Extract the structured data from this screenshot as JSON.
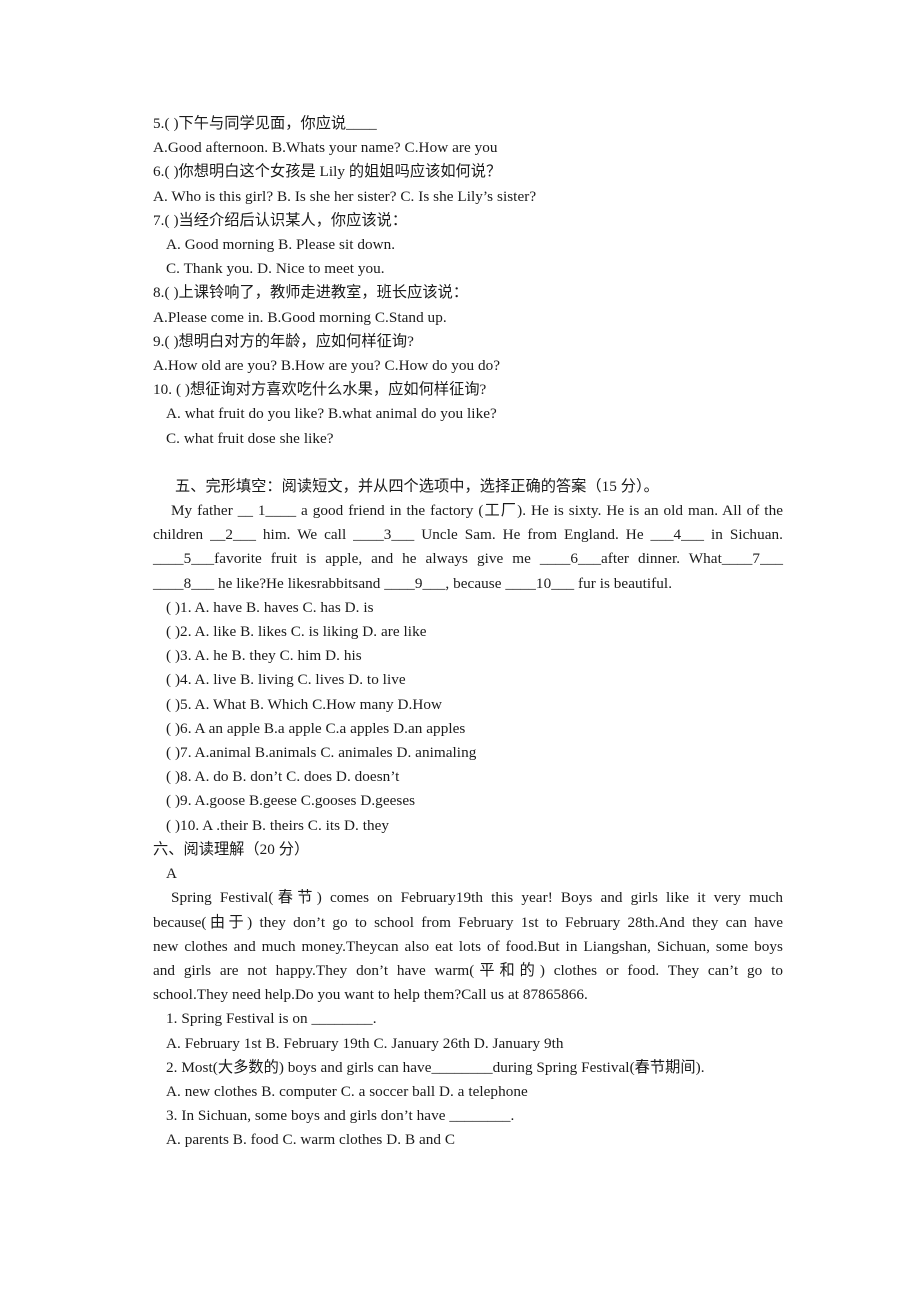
{
  "document": {
    "type": "exam-worksheet",
    "language": "zh-CN/en",
    "page_background": "#ffffff",
    "text_color": "#1a1a1a"
  },
  "part_four_items": [
    "5.( )下午与同学见面，你应说____",
    "A.Good afternoon. B.Whats your name? C.How are you",
    "6.( )你想明白这个女孩是 Lily 的姐姐吗应该如何说？",
    "A. Who is this girl? B. Is she her sister? C. Is she Lily’s sister?",
    "7.( )当经介绍后认识某人，你应该说：",
    "A. Good morning B. Please sit down.",
    "C. Thank you. D. Nice to meet you.",
    "8.( )上课铃响了，教师走进教室，班长应该说：",
    "A.Please come in. B.Good morning C.Stand up.",
    "9.( )想明白对方的年龄，应如何样征询?",
    "A.How old are you? B.How are you? C.How do you do?",
    "10. ( )想征询对方喜欢吃什么水果，应如何样征询?",
    "A. what fruit do you like? B.what animal do you like?",
    "C. what fruit dose she like?"
  ],
  "section_five": {
    "heading": "五、完形填空：阅读短文，并从四个选项中，选择正确的答案（15 分）。",
    "passage_lines": [
      "My father __ 1____ a good friend in the factory (工厂). He is sixty. He is an old man. All of the",
      "children __2___ him. We call ____3___ Uncle Sam. He from England. He ___4___ in Sichuan.",
      "____5___favorite fruit is apple, and he always give me ____6___after dinner. What____7___",
      "____8___ he like?He likesrabbitsand ____9___, because ____10___ fur is beautiful."
    ],
    "options": [
      "( )1. A. have B. haves C. has D. is",
      "( )2. A. like B. likes C. is liking D. are like",
      "( )3. A. he B. they C. him D. his",
      "( )4. A. live B. living C. lives D. to live",
      "( )5. A. What B. Which C.How many D.How",
      "( )6. A an apple B.a apple C.a apples D.an apples",
      "( )7. A.animal B.animals C. animales D. animaling",
      "( )8. A. do B. don’t C. does D. doesn’t",
      "( )9. A.goose B.geese C.gooses D.geeses",
      "( )10. A .their B. theirs C. its D. they"
    ]
  },
  "section_six": {
    "heading": "六、阅读理解（20 分）",
    "passage_label": "A",
    "passage_lines": [
      "Spring Festival(春节) comes on February19th this year! Boys and girls like it very much",
      "because(由于) they don’t go to school from February 1st to February 28th.And they can have",
      "new clothes and much money.Theycan also eat lots of food.But in Liangshan, Sichuan, some boys",
      "and girls are not happy.They don’t have warm(平和的) clothes or food. They can’t go to",
      "school.They need help.Do you want to help them?Call us at 87865866."
    ],
    "questions": [
      "1. Spring Festival is on ________.",
      "A. February 1st B. February 19th C. January 26th D. January 9th",
      "2. Most(大多数的) boys and girls can have________during Spring Festival(春节期间).",
      "A. new clothes B. computer C. a soccer ball D. a telephone",
      "3. In Sichuan, some boys and girls don’t have ________.",
      "A. parents B. food C. warm clothes D. B and C"
    ]
  }
}
